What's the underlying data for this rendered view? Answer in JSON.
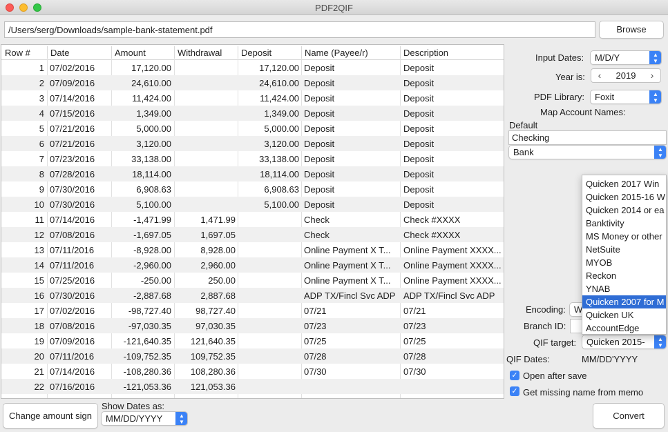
{
  "window": {
    "title": "PDF2QIF"
  },
  "file": {
    "path": "/Users/serg/Downloads/sample-bank-statement.pdf",
    "browse_label": "Browse"
  },
  "table": {
    "headers": [
      "Row #",
      "Date",
      "Amount",
      "Withdrawal",
      "Deposit",
      "Name (Payee/r)",
      "Description"
    ],
    "rows": [
      [
        "1",
        "07/02/2016",
        "17,120.00",
        "",
        "17,120.00",
        "Deposit",
        "Deposit"
      ],
      [
        "2",
        "07/09/2016",
        "24,610.00",
        "",
        "24,610.00",
        "Deposit",
        "Deposit"
      ],
      [
        "3",
        "07/14/2016",
        "11,424.00",
        "",
        "11,424.00",
        "Deposit",
        "Deposit"
      ],
      [
        "4",
        "07/15/2016",
        "1,349.00",
        "",
        "1,349.00",
        "Deposit",
        "Deposit"
      ],
      [
        "5",
        "07/21/2016",
        "5,000.00",
        "",
        "5,000.00",
        "Deposit",
        "Deposit"
      ],
      [
        "6",
        "07/21/2016",
        "3,120.00",
        "",
        "3,120.00",
        "Deposit",
        "Deposit"
      ],
      [
        "7",
        "07/23/2016",
        "33,138.00",
        "",
        "33,138.00",
        "Deposit",
        "Deposit"
      ],
      [
        "8",
        "07/28/2016",
        "18,114.00",
        "",
        "18,114.00",
        "Deposit",
        "Deposit"
      ],
      [
        "9",
        "07/30/2016",
        "6,908.63",
        "",
        "6,908.63",
        "Deposit",
        "Deposit"
      ],
      [
        "10",
        "07/30/2016",
        "5,100.00",
        "",
        "5,100.00",
        "Deposit",
        "Deposit"
      ],
      [
        "11",
        "07/14/2016",
        "-1,471.99",
        "1,471.99",
        "",
        "Check",
        "Check #XXXX"
      ],
      [
        "12",
        "07/08/2016",
        "-1,697.05",
        "1,697.05",
        "",
        "Check",
        "Check #XXXX"
      ],
      [
        "13",
        "07/11/2016",
        "-8,928.00",
        "8,928.00",
        "",
        "Online Payment X T...",
        "Online Payment XXXX..."
      ],
      [
        "14",
        "07/11/2016",
        "-2,960.00",
        "2,960.00",
        "",
        "Online Payment X T...",
        "Online Payment XXXX..."
      ],
      [
        "15",
        "07/25/2016",
        "-250.00",
        "250.00",
        "",
        "Online Payment X T...",
        "Online Payment XXXX..."
      ],
      [
        "16",
        "07/30/2016",
        "-2,887.68",
        "2,887.68",
        "",
        "ADP TX/Fincl Svc ADP",
        "ADP TX/Fincl Svc ADP"
      ],
      [
        "17",
        "07/02/2016",
        "-98,727.40",
        "98,727.40",
        "",
        "07/21",
        "07/21"
      ],
      [
        "18",
        "07/08/2016",
        "-97,030.35",
        "97,030.35",
        "",
        "07/23",
        "07/23"
      ],
      [
        "19",
        "07/09/2016",
        "-121,640.35",
        "121,640.35",
        "",
        "07/25",
        "07/25"
      ],
      [
        "20",
        "07/11/2016",
        "-109,752.35",
        "109,752.35",
        "",
        "07/28",
        "07/28"
      ],
      [
        "21",
        "07/14/2016",
        "-108,280.36",
        "108,280.36",
        "",
        "07/30",
        "07/30"
      ],
      [
        "22",
        "07/16/2016",
        "-121,053.36",
        "121,053.36",
        "",
        "",
        ""
      ]
    ]
  },
  "settings": {
    "input_dates_label": "Input Dates:",
    "input_dates_value": "M/D/Y",
    "year_label": "Year is:",
    "year_value": "2019",
    "pdf_library_label": "PDF Library:",
    "pdf_library_value": "Foxit",
    "map_accounts_label": "Map Account Names:",
    "default_label": "Default",
    "account_name_value": "Checking",
    "account_type_value": "Bank",
    "encoding_label": "Encoding:",
    "encoding_value": "W",
    "branch_id_label": "Branch ID:",
    "qif_target_label": "QIF target:",
    "qif_target_value": "Quicken 2015-",
    "qif_dates_label": "QIF Dates:",
    "qif_dates_value": "MM/DD'YYYY",
    "open_after_save_label": "Open after save",
    "open_after_save_checked": true,
    "missing_name_label": "Get missing name from memo",
    "missing_name_checked": true
  },
  "qif_target_options": [
    "Quicken 2017 Win",
    "Quicken 2015-16 W",
    "Quicken 2014 or ea",
    "Banktivity",
    "MS Money or other",
    "NetSuite",
    "MYOB",
    "Reckon",
    "YNAB",
    "Quicken 2007 for M",
    "Quicken UK",
    "AccountEdge"
  ],
  "qif_target_highlighted_index": 9,
  "bottom": {
    "change_sign_label": "Change amount sign",
    "show_dates_label": "Show Dates as:",
    "show_dates_value": "MM/DD/YYYY",
    "convert_label": "Convert"
  },
  "colors": {
    "accent": "#3b82f6",
    "selection": "#2f6dd5",
    "row_alt": "#f0f0f0"
  }
}
